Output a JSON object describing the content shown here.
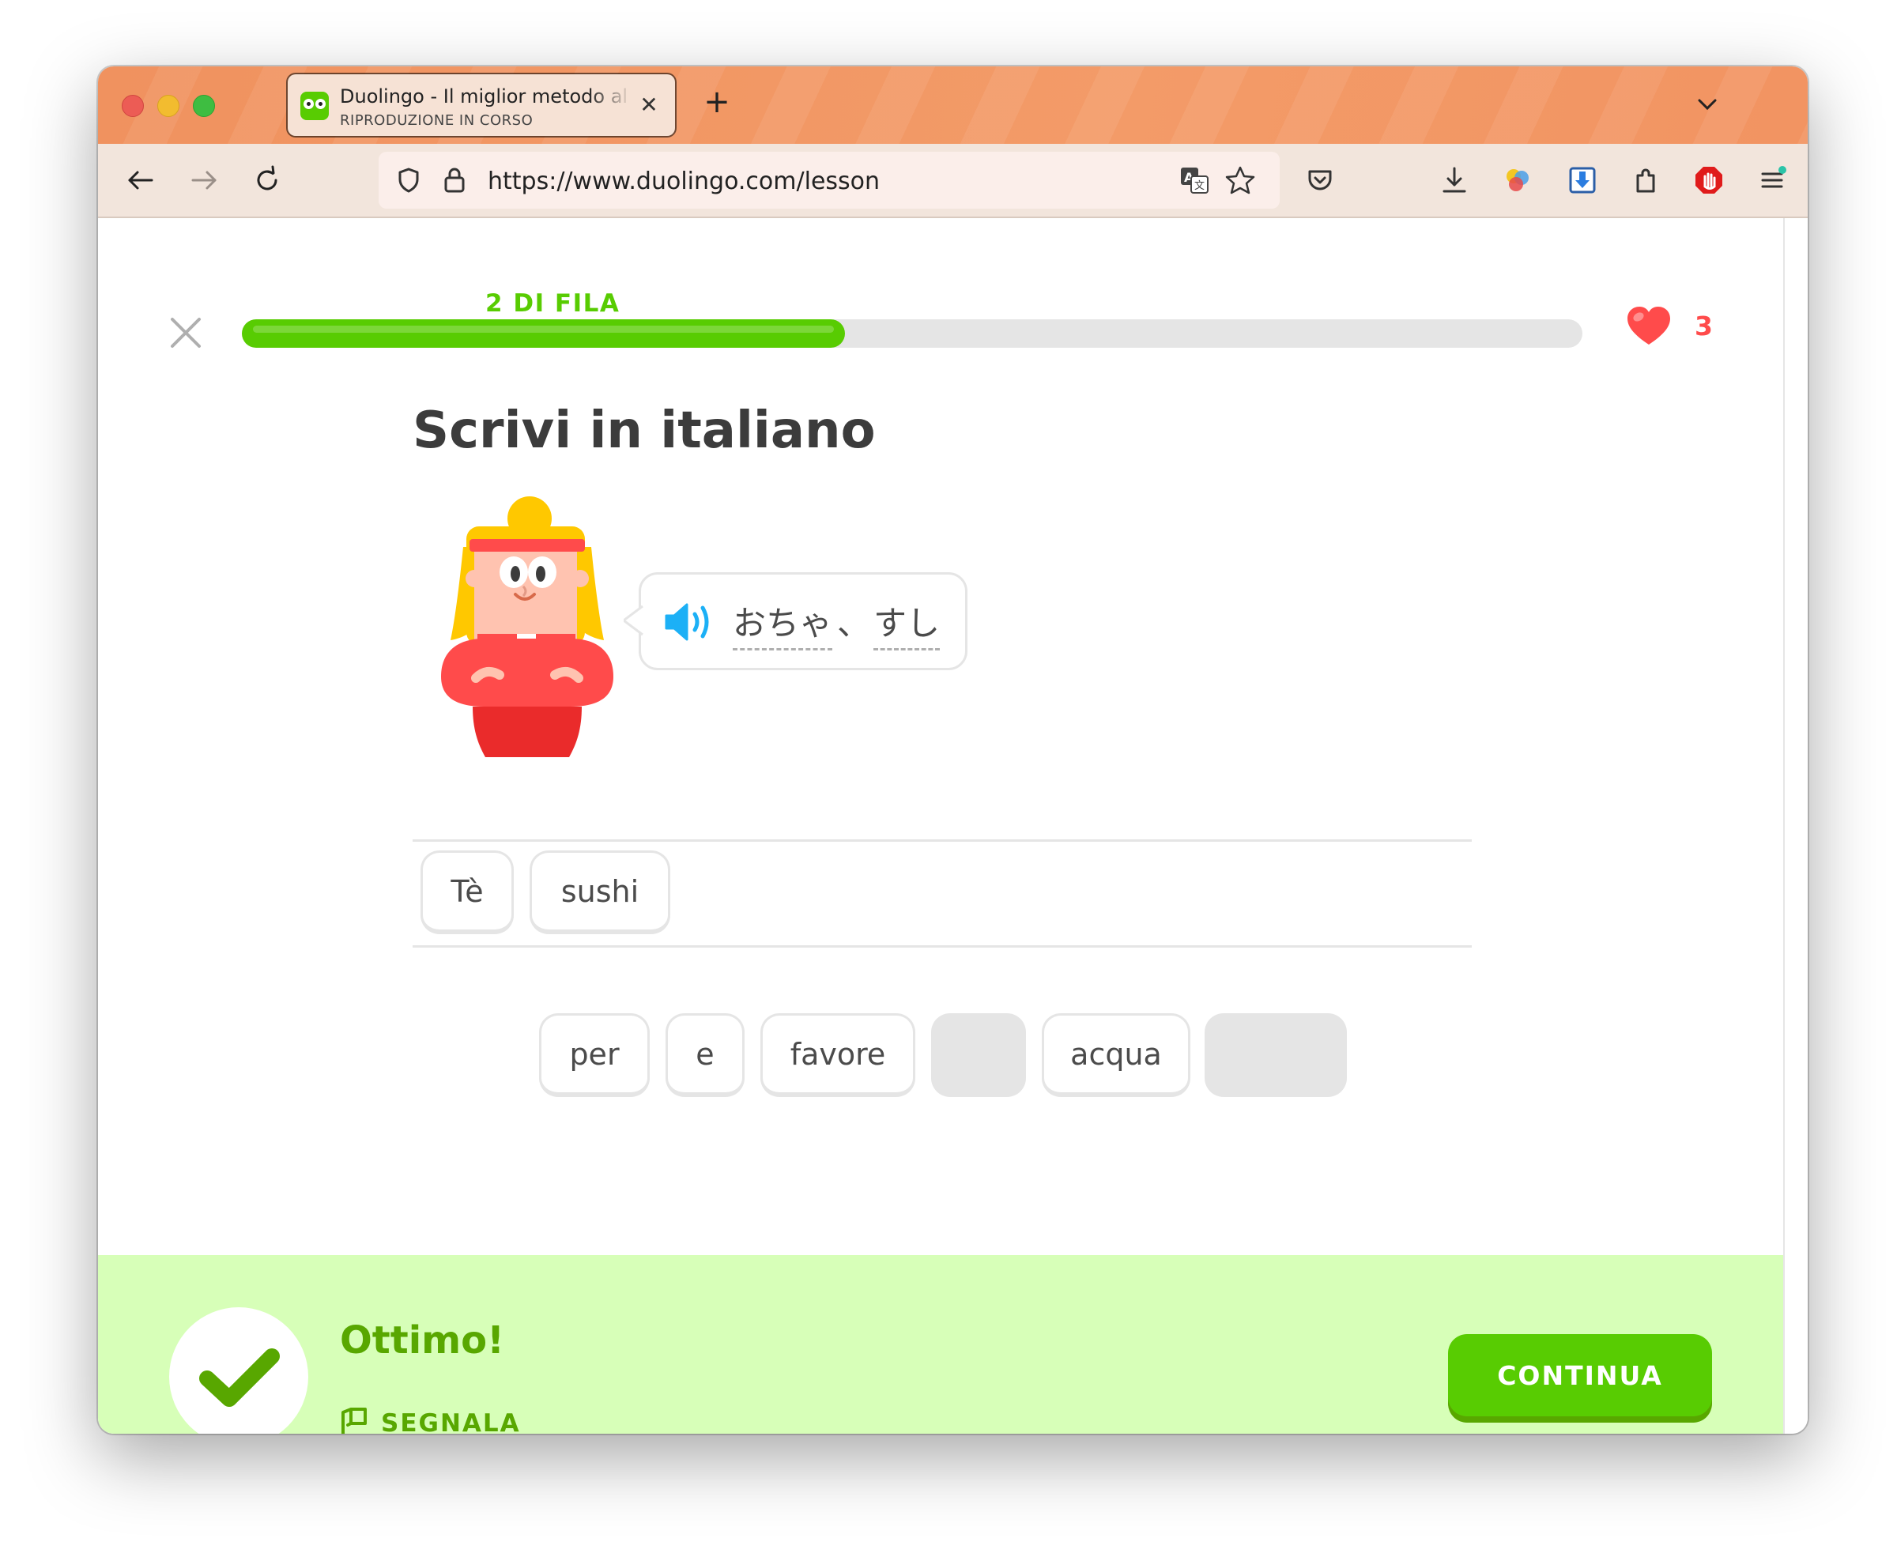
{
  "browser": {
    "tab": {
      "title": "Duolingo - Il miglior metodo al mondo per imparare le lingue",
      "subtitle": "RIPRODUZIONE IN CORSO",
      "favicon": "duolingo-icon"
    },
    "url": "https://www.duolingo.com/lesson"
  },
  "lesson": {
    "streak_label": "2 DI FILA",
    "progress": 0.45,
    "hearts": "3",
    "instruction": "Scrivi in italiano",
    "prompt_words": [
      "おちゃ",
      "、",
      "すし"
    ],
    "answer_tiles": [
      "Tè",
      "sushi"
    ],
    "word_bank": [
      {
        "label": "per",
        "used": false
      },
      {
        "label": "e",
        "used": false
      },
      {
        "label": "favore",
        "used": false
      },
      {
        "label": "",
        "used": true
      },
      {
        "label": "acqua",
        "used": false
      },
      {
        "label": "",
        "used": true
      }
    ]
  },
  "feedback": {
    "title": "Ottimo!",
    "report_label": "SEGNALA",
    "continue_label": "CONTINUA"
  },
  "colors": {
    "accent_green": "#58cc02",
    "dark_green": "#58a700",
    "heart_red": "#ff4b4b",
    "feedback_bg": "#d7ffb8",
    "titlebar_orange": "#f39b68"
  }
}
